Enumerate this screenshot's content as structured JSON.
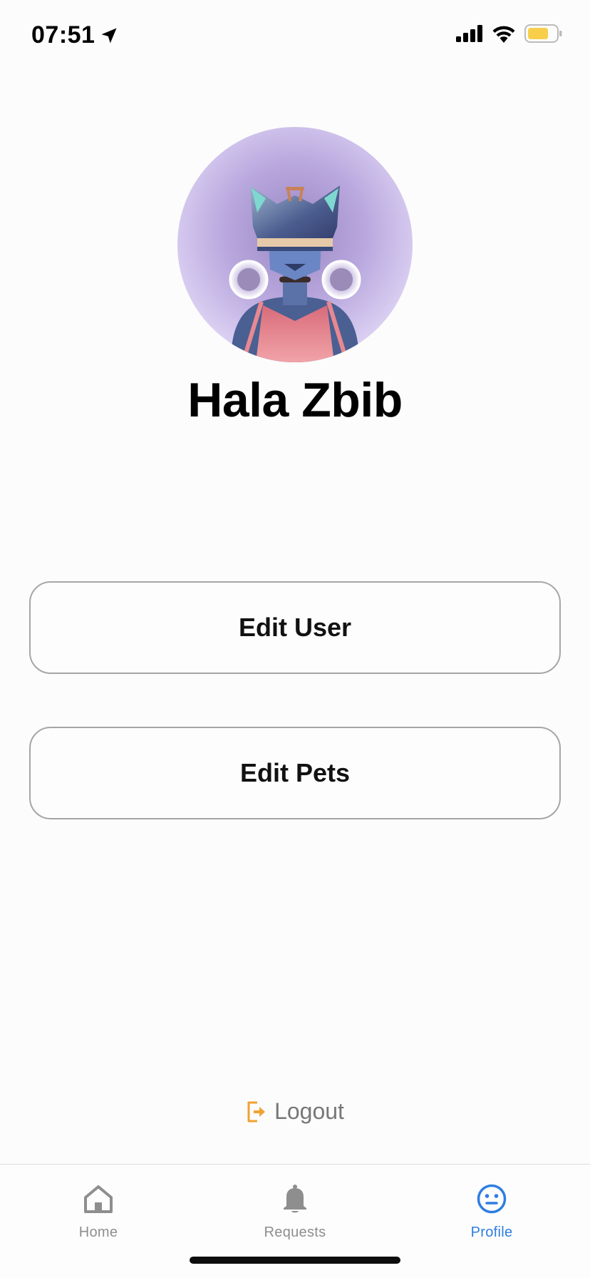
{
  "status_bar": {
    "time": "07:51",
    "icons": [
      "location-arrow-icon",
      "signal-icon",
      "wifi-icon",
      "battery-icon"
    ],
    "battery_color": "#f7cf4b"
  },
  "profile": {
    "name": "Hala Zbib",
    "avatar_colors": {
      "background": "#d8cdf1",
      "figure": "#4a5f92",
      "shirt": "#e88891"
    }
  },
  "actions": {
    "edit_user": "Edit User",
    "edit_pets": "Edit Pets"
  },
  "logout": {
    "label": "Logout",
    "icon": "logout-icon",
    "icon_color": "#f0a233"
  },
  "tab_bar": {
    "tabs": [
      {
        "label": "Home",
        "icon": "home-icon",
        "active": false
      },
      {
        "label": "Requests",
        "icon": "bell-icon",
        "active": false
      },
      {
        "label": "Profile",
        "icon": "smiley-icon",
        "active": true
      }
    ],
    "active_color": "#2f7de1",
    "inactive_color": "#8e8e8e"
  }
}
